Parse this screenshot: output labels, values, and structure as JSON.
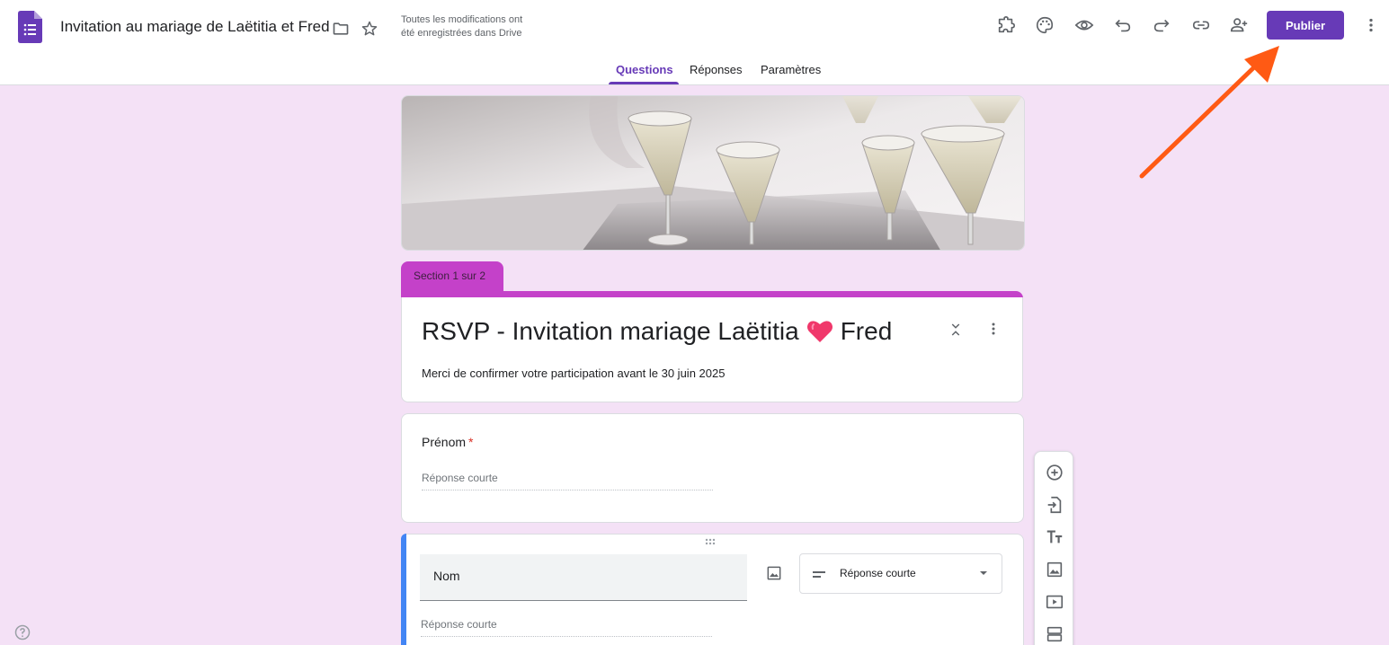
{
  "header": {
    "doc_title": "Invitation au mariage de Laëtitia et Fred",
    "save_status_line1": "Toutes les modifications ont",
    "save_status_line2": "été enregistrées dans Drive",
    "publish_label": "Publier",
    "icons": [
      "forms-logo-icon",
      "folder-icon",
      "star-icon",
      "addons-icon",
      "palette-icon",
      "preview-eye-icon",
      "undo-icon",
      "redo-icon",
      "link-icon",
      "add-collaborator-icon",
      "more-vert-icon"
    ]
  },
  "tabs": [
    {
      "label": "Questions",
      "active": true
    },
    {
      "label": "Réponses",
      "active": false
    },
    {
      "label": "Paramètres",
      "active": false
    }
  ],
  "section": {
    "label": "Section 1 sur 2",
    "title_before_heart": "RSVP - Invitation mariage Laëtitia",
    "title_after_heart": "Fred",
    "description": "Merci de confirmer votre participation avant le 30 juin 2025"
  },
  "questions": [
    {
      "title": "Prénom",
      "required_mark": "*",
      "placeholder": "Réponse courte"
    },
    {
      "title": "Nom",
      "type": "Réponse courte",
      "placeholder": "Réponse courte"
    }
  ],
  "colors": {
    "accent": "#673ab7",
    "section": "#c441c9",
    "background": "#f4e1f6",
    "focus_bar": "#4285f4",
    "annotation_arrow": "#ff5a14"
  }
}
